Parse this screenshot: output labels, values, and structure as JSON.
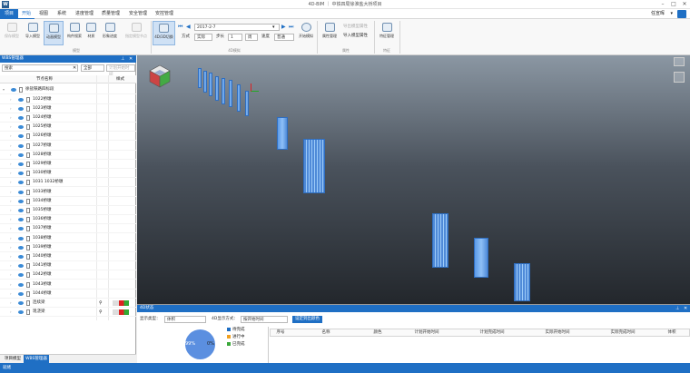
{
  "app": {
    "logo": "W",
    "title": "4D-BIM ｜ 中铁四局徐淮盐大桥项目",
    "user": "任宣晖"
  },
  "menu": [
    "项目",
    "开始",
    "视图",
    "系统",
    "进度管理",
    "质量管理",
    "安全管理",
    "安控管理"
  ],
  "ribbon": {
    "buttons": [
      "保存模型",
      "导入模型",
      "动画模型",
      "构件搜索",
      "材质",
      "形象进度",
      "指定模型节点",
      "4D/3D切换",
      "开始模拟",
      "属性管理",
      "导入模型属性",
      "特征管理"
    ],
    "groups": [
      "模型",
      "4D模拟",
      "属性",
      "特征"
    ],
    "date": "2017-2-7",
    "mode_label": "方式",
    "mode_value": "实际",
    "step_label": "步长",
    "step_value": "1",
    "unit": "周",
    "speed_label": "速度",
    "speed_value": "普通",
    "attr_import": "导入模型属性",
    "attr_export": "导出模型属性"
  },
  "wbs": {
    "title": "WBS管理器",
    "search_placeholder": "搜索",
    "filter": "全部",
    "filter2_placeholder": "计划开始时间",
    "col_name": "节点名称",
    "col_style": "样式",
    "root": "徐盐铁路四标段",
    "items": [
      "1022桥墩",
      "1023桥墩",
      "1024桥墩",
      "1025桥墩",
      "1026桥墩",
      "1027桥墩",
      "1028桥墩",
      "1029桥墩",
      "1030桥墩",
      "1031 1032桥墩",
      "1033桥墩",
      "1034桥墩",
      "1035桥墩",
      "1036桥墩",
      "1037桥墩",
      "1038桥墩",
      "1039桥墩",
      "1040桥墩",
      "1041桥墩",
      "1042桥墩",
      "1043桥墩",
      "1044桥墩",
      "连续梁",
      "现浇梁"
    ]
  },
  "tabs": [
    "项目模型",
    "WBS管理器"
  ],
  "bottom": {
    "title": "4D状态",
    "display_label": "显示类型：",
    "display_value": "体积",
    "show_label": "4D显示方式：",
    "show_value": "按开始时间",
    "confirm": "设定到出颜色",
    "pie_pct": "99%",
    "pie_pct2": "0%",
    "legend": [
      "待完成",
      "进行中",
      "已完成"
    ],
    "legend_colors": [
      "#1f6fc4",
      "#f0a020",
      "#3aa83a"
    ],
    "columns": [
      "序号",
      "名称",
      "颜色",
      "计划开始时间",
      "计划完成时间",
      "实际开始时间",
      "实际完成时间",
      "体积"
    ]
  },
  "status": "就绪"
}
